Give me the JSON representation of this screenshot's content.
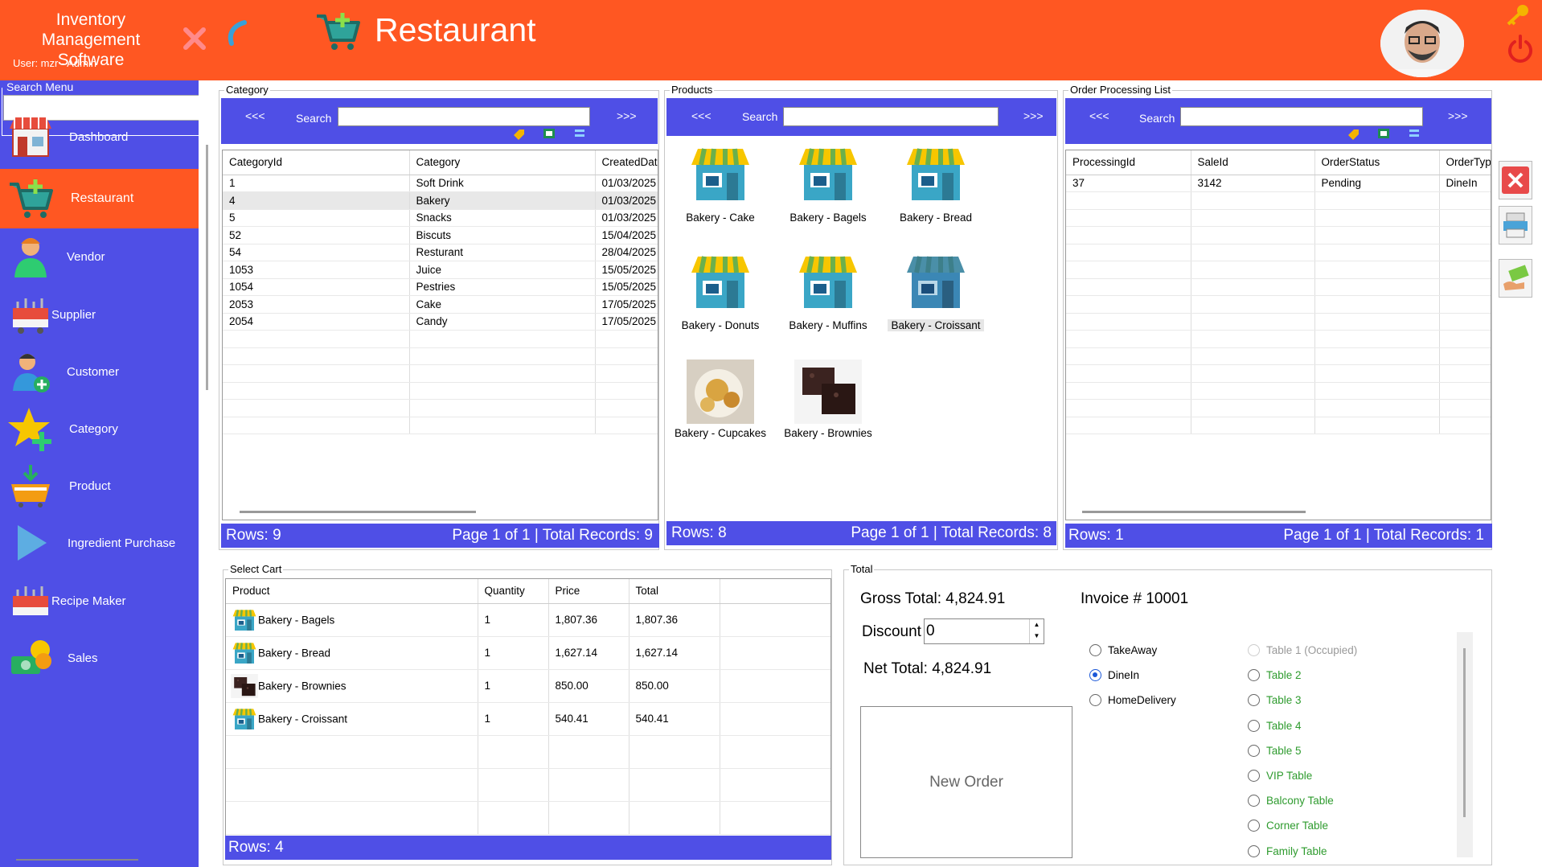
{
  "app": {
    "title_line1": "Inventory Management",
    "title_line2": "Software",
    "user": "User: mzr - Admin",
    "page_title": "Restaurant"
  },
  "sidebar": {
    "search_legend": "Search Menu",
    "search_value": "",
    "items": [
      {
        "label": "Dashboard",
        "icon": "shop-icon"
      },
      {
        "label": "Restaurant",
        "icon": "cart-add-icon",
        "active": true
      },
      {
        "label": "Vendor",
        "icon": "vendor-person-icon"
      },
      {
        "label": "Supplier",
        "icon": "supplier-icon"
      },
      {
        "label": "Customer",
        "icon": "customer-add-icon"
      },
      {
        "label": "Category",
        "icon": "star-add-icon"
      },
      {
        "label": "Product",
        "icon": "product-basket-icon"
      },
      {
        "label": "Ingredient Purchase",
        "icon": "play-icon"
      },
      {
        "label": "Recipe Maker",
        "icon": "recipe-icon"
      },
      {
        "label": "Sales",
        "icon": "coins-icon"
      }
    ]
  },
  "category": {
    "legend": "Category",
    "prev": "<<<",
    "next": ">>>",
    "search_label": "Search",
    "search_value": "",
    "columns": [
      "CategoryId",
      "Category",
      "CreatedDate"
    ],
    "rows": [
      [
        "1",
        "Soft Drink",
        "01/03/2025"
      ],
      [
        "4",
        "Bakery",
        "01/03/2025"
      ],
      [
        "5",
        "Snacks",
        "01/03/2025"
      ],
      [
        "52",
        "Biscuts",
        "15/04/2025"
      ],
      [
        "54",
        "Resturant",
        "28/04/2025"
      ],
      [
        "1053",
        "Juice",
        "15/05/2025"
      ],
      [
        "1054",
        "Pestries",
        "15/05/2025"
      ],
      [
        "2053",
        "Cake",
        "17/05/2025"
      ],
      [
        "2054",
        "Candy",
        "17/05/2025"
      ]
    ],
    "selected_row": 1,
    "rows_text": "Rows: 9",
    "page_text": "Page 1 of 1 | Total Records: 9"
  },
  "products": {
    "legend": "Products",
    "prev": "<<<",
    "next": ">>>",
    "search_label": "Search",
    "search_value": "",
    "items": [
      {
        "name": "Bakery - Cake",
        "img": "shop"
      },
      {
        "name": "Bakery - Bagels",
        "img": "shop"
      },
      {
        "name": "Bakery - Bread",
        "img": "shop"
      },
      {
        "name": "Bakery - Donuts",
        "img": "shop"
      },
      {
        "name": "Bakery - Muffins",
        "img": "shop"
      },
      {
        "name": "Bakery - Croissant",
        "img": "shop",
        "selected": true
      },
      {
        "name": "Bakery - Cupcakes",
        "img": "cupcakes"
      },
      {
        "name": "Bakery - Brownies",
        "img": "brownies"
      }
    ],
    "rows_text": "Rows: 8",
    "page_text": "Page 1 of 1 | Total Records: 8"
  },
  "orders": {
    "legend": "Order Processing List",
    "prev": "<<<",
    "next": ">>>",
    "search_label": "Search",
    "search_value": "",
    "columns": [
      "ProcessingId",
      "SaleId",
      "OrderStatus",
      "OrderType"
    ],
    "rows": [
      [
        "37",
        "3142",
        "Pending",
        "DineIn"
      ]
    ],
    "rows_text": "Rows: 1",
    "page_text": "Page 1 of 1 | Total Records: 1"
  },
  "cart": {
    "legend": "Select Cart",
    "columns": [
      "Product",
      "Quantity",
      "Price",
      "Total"
    ],
    "rows": [
      {
        "product": "Bakery - Bagels",
        "img": "shop",
        "qty": "1",
        "price": "1,807.36",
        "total": "1,807.36"
      },
      {
        "product": "Bakery - Bread",
        "img": "shop",
        "qty": "1",
        "price": "1,627.14",
        "total": "1,627.14"
      },
      {
        "product": "Bakery - Brownies",
        "img": "brownies",
        "qty": "1",
        "price": "850.00",
        "total": "850.00"
      },
      {
        "product": "Bakery - Croissant",
        "img": "shop",
        "qty": "1",
        "price": "540.41",
        "total": "540.41"
      }
    ],
    "rows_text": "Rows: 4"
  },
  "total": {
    "legend": "Total",
    "gross": "Gross Total: 4,824.91",
    "invoice": "Invoice # 10001",
    "discount_label": "Discount",
    "discount_value": "0",
    "net": "Net Total: 4,824.91",
    "new_order": "New Order",
    "order_types": [
      {
        "label": "TakeAway",
        "checked": false
      },
      {
        "label": "DineIn",
        "checked": true
      },
      {
        "label": "HomeDelivery",
        "checked": false
      }
    ],
    "tables": [
      {
        "label": "Table 1 (Occupied)",
        "disabled": true
      },
      {
        "label": "Table 2"
      },
      {
        "label": "Table 3"
      },
      {
        "label": "Table 4"
      },
      {
        "label": "Table 5"
      },
      {
        "label": "VIP Table"
      },
      {
        "label": "Balcony Table"
      },
      {
        "label": "Corner Table"
      },
      {
        "label": "Family Table"
      }
    ]
  },
  "colors": {
    "header": "#ff5722",
    "sidebar": "#4f4fe6",
    "accent_blue": "#4f4fe6",
    "green": "#2e9b2e"
  }
}
